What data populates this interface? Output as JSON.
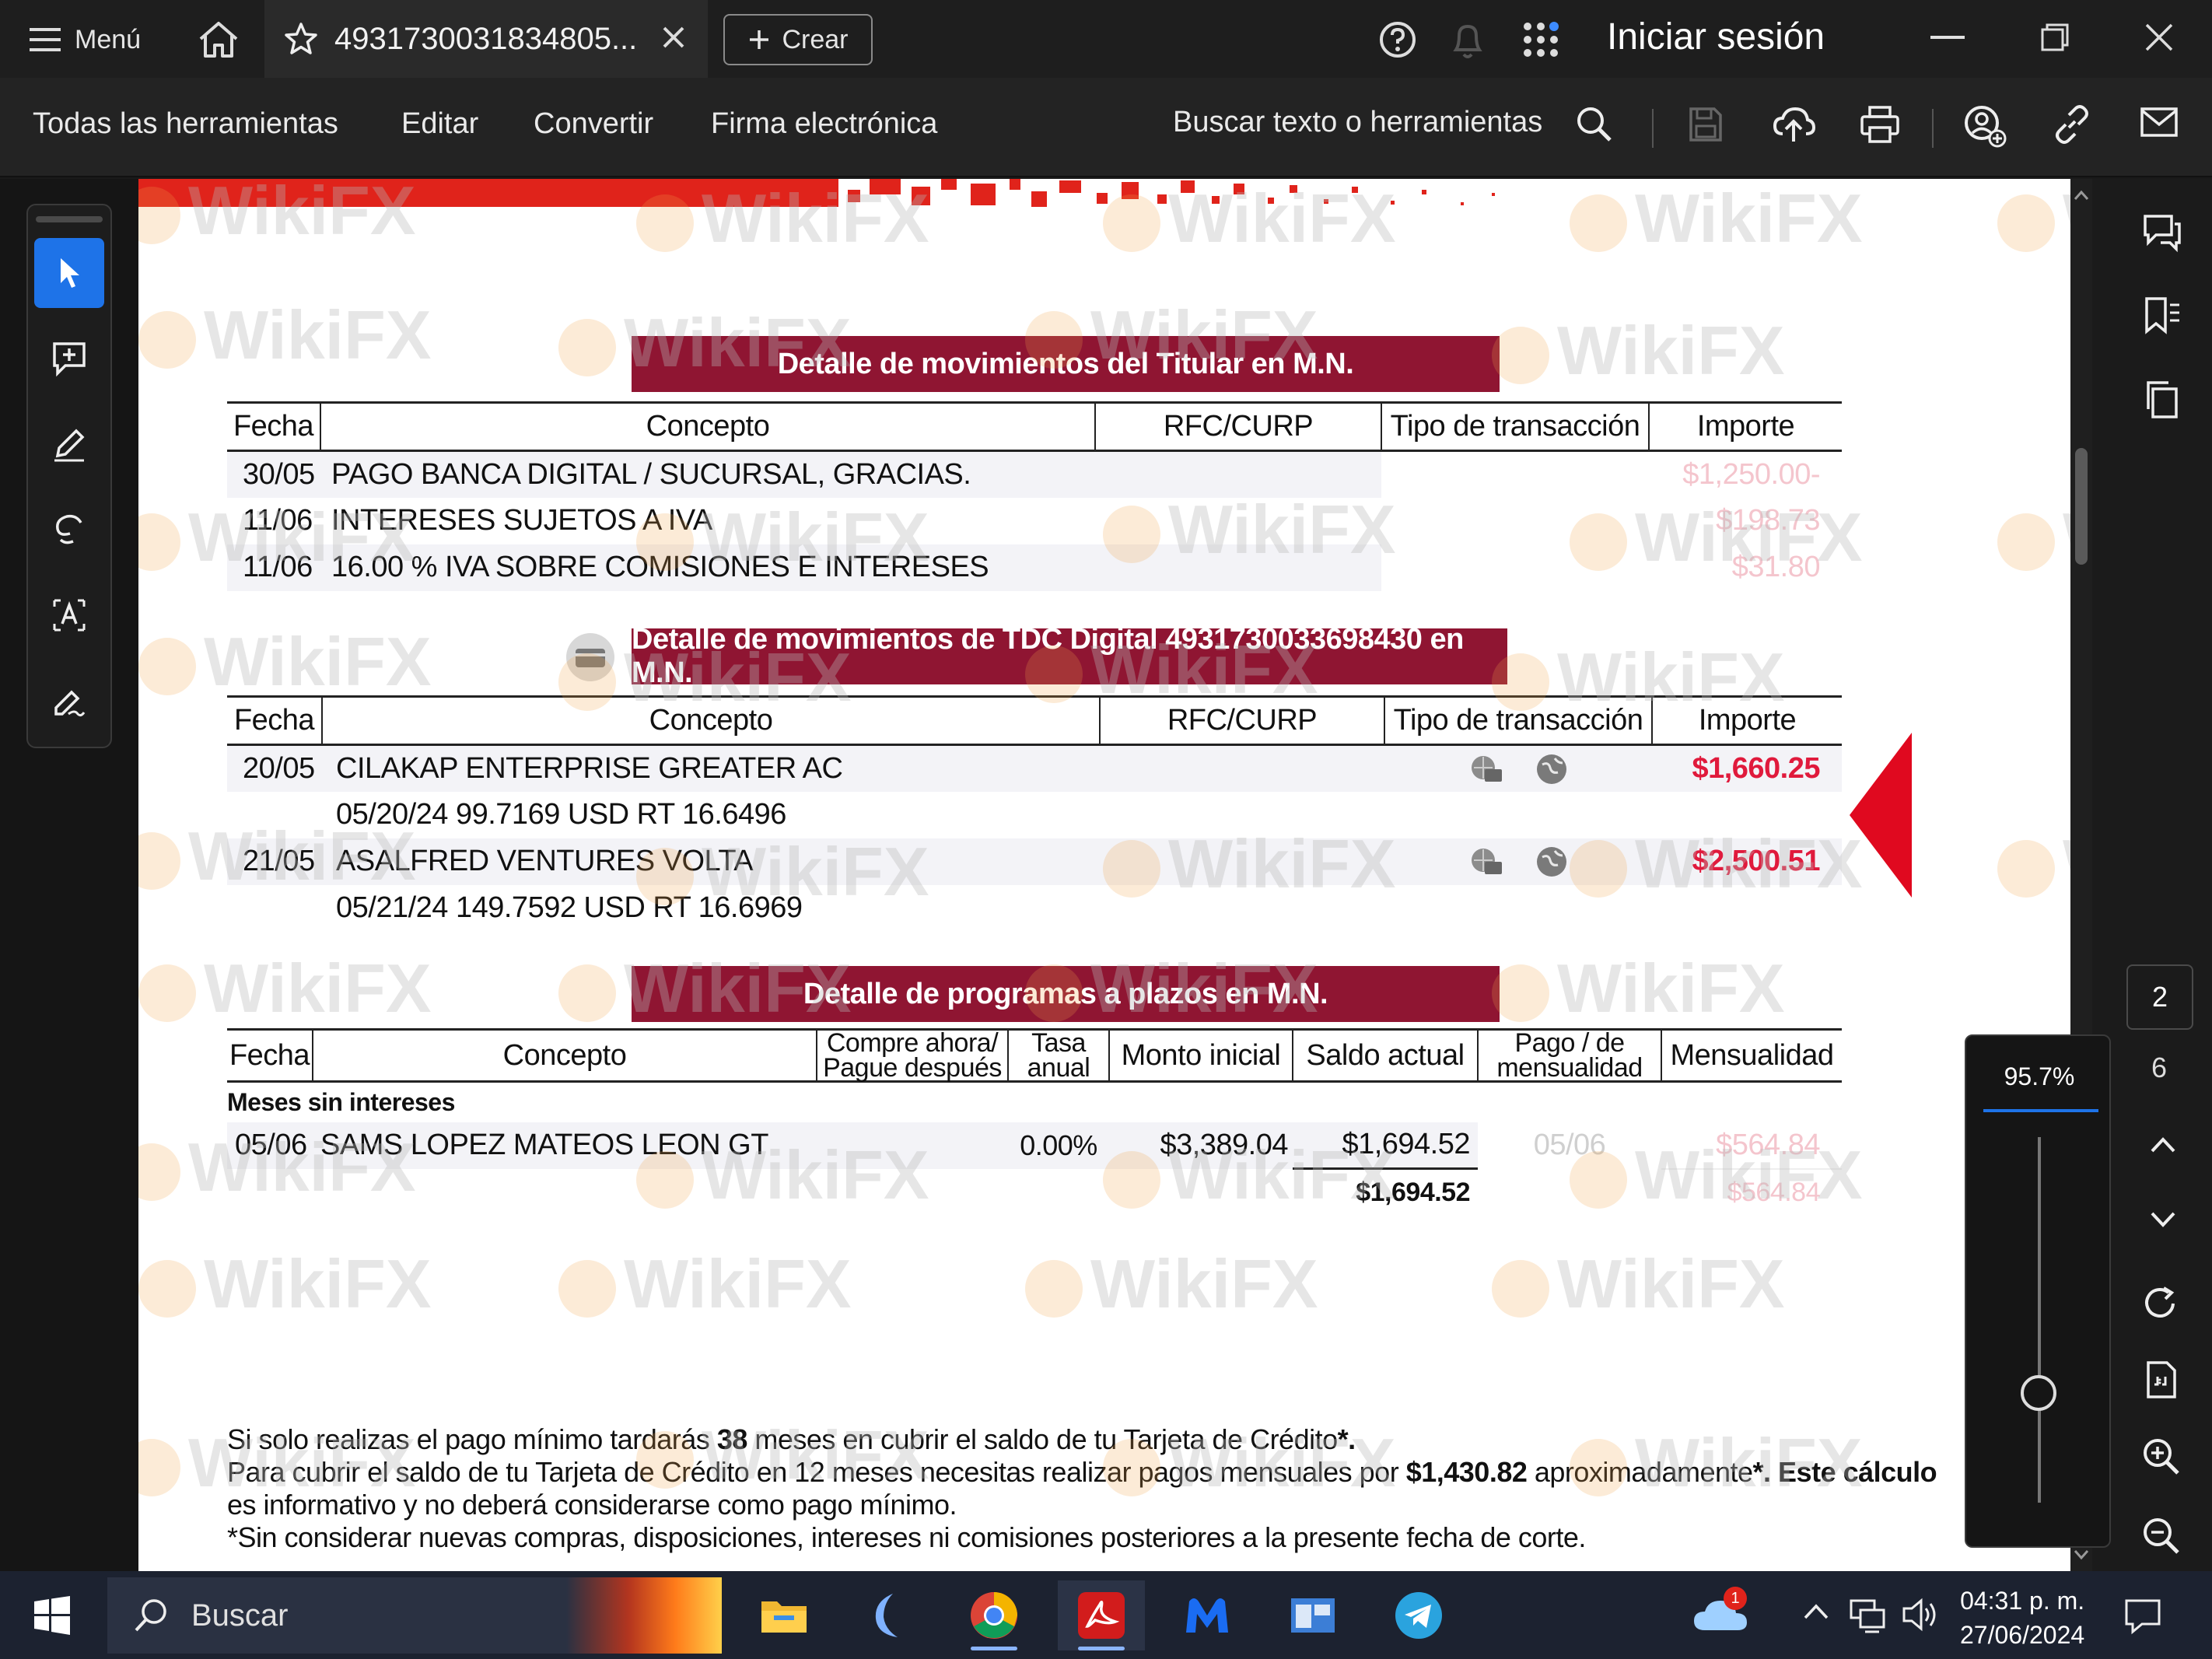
{
  "titlebar": {
    "menu_label": "Menú",
    "tab_title": "4931730031834805...",
    "create_label": "Crear",
    "signin_label": "Iniciar sesión"
  },
  "toolbar": {
    "all_tools": "Todas las herramientas",
    "edit": "Editar",
    "convert": "Convertir",
    "esign": "Firma electrónica",
    "search_placeholder": "Buscar texto o herramientas"
  },
  "document": {
    "section1": {
      "title": "Detalle de movimientos del Titular  en M.N.",
      "headers": [
        "Fecha",
        "Concepto",
        "RFC/CURP",
        "Tipo de transacción",
        "Importe"
      ],
      "rows": [
        {
          "fecha": "30/05",
          "concepto": "PAGO BANCA DIGITAL / SUCURSAL, GRACIAS.",
          "importe": "$1,250.00-"
        },
        {
          "fecha": "11/06",
          "concepto": "INTERESES SUJETOS A IVA",
          "importe": "$198.73"
        },
        {
          "fecha": "11/06",
          "concepto": "16.00 % IVA SOBRE COMISIONES E INTERESES",
          "importe": "$31.80"
        }
      ]
    },
    "section2": {
      "title": "Detalle de movimientos de TDC Digital 4931730033698430 en M.N.",
      "headers": [
        "Fecha",
        "Concepto",
        "RFC/CURP",
        "Tipo de transacción",
        "Importe"
      ],
      "rows": [
        {
          "fecha": "20/05",
          "concepto": "CILAKAP ENTERPRISE GREATER AC",
          "detalle": "05/20/24 99.7169 USD RT 16.6496",
          "importe": "$1,660.25"
        },
        {
          "fecha": "21/05",
          "concepto": "ASALFRED VENTURES VOLTA",
          "detalle": "05/21/24 149.7592 USD RT 16.6969",
          "importe": "$2,500.51"
        }
      ]
    },
    "section3": {
      "title": "Detalle de programas a plazos en M.N.",
      "headers": [
        "Fecha",
        "Concepto",
        "Compre ahora/ Pague después",
        "Tasa anual",
        "Monto inicial",
        "Saldo actual",
        "Pago / de mensualidad",
        "Mensualidad"
      ],
      "group": "Meses sin intereses",
      "row": {
        "fecha": "05/06",
        "concepto": "SAMS LOPEZ MATEOS LEON GT",
        "tasa": "0.00%",
        "monto": "$3,389.04",
        "saldo": "$1,694.52",
        "pago": "05/06",
        "mensualidad": "$564.84"
      },
      "total_saldo": "$1,694.52",
      "total_mensualidad": "$564.84"
    },
    "footer": {
      "line1_a": "Si solo realizas el pago mínimo tardarás ",
      "line1_b": "38",
      "line1_c": " meses en cubrir el saldo de tu Tarjeta de Crédito",
      "line1_d": "*.",
      "line2_a": "Para cubrir el saldo de tu Tarjeta de Crédito en 12 meses necesitas realizar pagos mensuales por ",
      "line2_b": "$1,430.82",
      "line2_c": " aproximadamente",
      "line2_d": "*. Este cálculo",
      "line3": "es informativo y no deberá considerarse como pago mínimo.",
      "line4": "*Sin considerar nuevas compras, disposiciones, intereses ni comisiones posteriores a la presente fecha de corte."
    },
    "watermark": "WikiFX"
  },
  "viewer": {
    "current_page": "2",
    "total_pages": "6",
    "zoom": "95.7%",
    "zoom_level": 0.3
  },
  "taskbar": {
    "search_placeholder": "Buscar",
    "time": "04:31 p. m.",
    "date": "27/06/2024",
    "weather_badge": "1"
  },
  "colors": {
    "accent": "#1e73e8",
    "section_header": "#8f1532",
    "amount_red": "#e01a3c"
  }
}
